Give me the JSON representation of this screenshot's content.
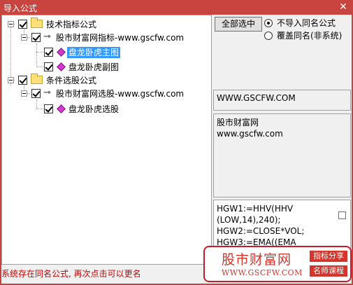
{
  "window": {
    "title": "导入公式",
    "close_glyph": "✕"
  },
  "tree": {
    "nodes": [
      {
        "label": "技术指标公式",
        "icon": "folder-icon",
        "checked": true
      },
      {
        "label": "股市财富网指标-www.gscfw.com",
        "icon": "key-icon",
        "checked": true
      },
      {
        "label": "盘龙卧虎主图",
        "icon": "formula-diamond-icon",
        "checked": true,
        "selected": true
      },
      {
        "label": "盘龙卧虎副图",
        "icon": "formula-diamond-icon",
        "checked": true
      },
      {
        "label": "条件选股公式",
        "icon": "folder-icon",
        "checked": true
      },
      {
        "label": "股市财富网选股-www.gscfw.com",
        "icon": "key-icon",
        "checked": true
      },
      {
        "label": "盘龙卧虎选股",
        "icon": "formula-diamond-icon",
        "checked": true
      }
    ]
  },
  "controls": {
    "select_all_label": "全部选中",
    "radio_options": [
      {
        "label": "不导入同名公式",
        "selected": true
      },
      {
        "label": "覆盖同名(非系统)",
        "selected": false
      }
    ]
  },
  "info": {
    "url": "WWW.GSCFW.COM",
    "description_lines": [
      "股市财富网",
      "www.gscfw.com"
    ],
    "code_lines": [
      "HGW1:=HHV(HHV",
      "(LOW,14),240);",
      "HGW2:=CLOSE*VOL;",
      "HGW3:=EMA((EMA"
    ]
  },
  "status_text": "系统存在同名公式, 再次点击可以更名",
  "logo": {
    "name": "股市财富网",
    "url": "WWW.GSCFW.COM",
    "tag1": "指标分享",
    "tag2": "名师课程",
    "brand_color": "#d4342a"
  },
  "colors": {
    "titlebar": "#c9443f",
    "selection": "#3399ff",
    "status": "#cc0000"
  }
}
